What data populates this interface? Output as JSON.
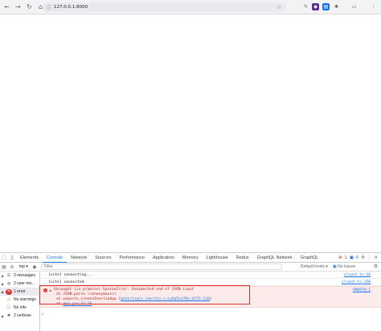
{
  "browser": {
    "url": "127.0.0.1:8000",
    "nav_back": "←",
    "nav_forward": "→",
    "nav_reload": "↻",
    "nav_home": "⌂"
  },
  "devtools": {
    "tabs": [
      "Elements",
      "Console",
      "Network",
      "Sources",
      "Performance",
      "Application",
      "Memory",
      "Lighthouse",
      "Redux",
      "GraphQL Network",
      "GraphQL"
    ],
    "active_tab": "Console",
    "error_count": "1",
    "issue_count": "6",
    "context": "top ▾",
    "filter_placeholder": "Filter",
    "levels": "Default levels ▾",
    "no_issues": "No Issues",
    "issues_count_right": "6"
  },
  "sidebar": {
    "items": [
      {
        "label": "3 messages",
        "icon": "list-icon"
      },
      {
        "label": "2 user me...",
        "icon": "user-icon"
      },
      {
        "label": "1 error",
        "icon": "error-icon"
      },
      {
        "label": "No warnings",
        "icon": "warning-icon"
      },
      {
        "label": "No info",
        "icon": "info-icon"
      },
      {
        "label": "2 verbose",
        "icon": "bug-icon"
      }
    ]
  },
  "console": {
    "messages": [
      {
        "text": "[vite] connecting...",
        "source": "client.ts:18"
      },
      {
        "text": "[vite] connected.",
        "source": "client.ts:150"
      }
    ],
    "error": {
      "line1": "Uncaught (in promise) SyntaxError: Unexpected end of JSON input",
      "line2": "at JSON.parse (<anonymous>)",
      "line3_prefix": "at exports.createInertiaApp (",
      "line3_link": "@inertiajs_inertia-r…v=6a5ce78e:4725:118",
      "line3_suffix": ")",
      "line4_prefix": "at ",
      "line4_link": "app.jsx:32:10",
      "source": "VM6979:1"
    }
  }
}
